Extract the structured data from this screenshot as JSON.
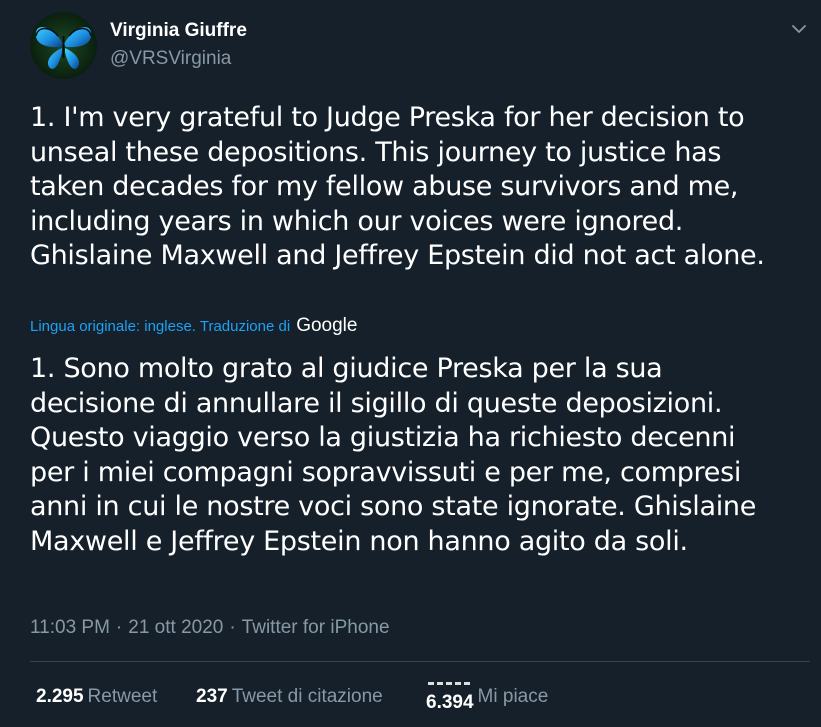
{
  "author": {
    "display_name": "Virginia Giuffre",
    "handle": "@VRSVirginia",
    "avatar_icon": "butterfly-avatar"
  },
  "menu": {
    "icon": "chevron-down-icon"
  },
  "tweet": {
    "text": "1. I'm very grateful to Judge Preska for her decision to\nunseal these depositions. This journey to justice has\ntaken decades for my fellow abuse survivors and me,\nincluding years in which our voices were ignored.\nGhislaine Maxwell and Jeffrey Epstein did not act alone.",
    "translation_note": "Lingua originale: inglese. Traduzione di",
    "translation_provider": "Google",
    "translated_text": "1. Sono molto grato al giudice Preska per la sua\ndecisione di annullare il sigillo di queste deposizioni.\nQuesto viaggio verso la giustizia ha richiesto decenni\nper i miei compagni sopravvissuti e per me, compresi\nanni in cui le nostre voci sono state ignorate. Ghislaine\nMaxwell e Jeffrey Epstein non hanno agito da soli.",
    "time": "11:03 PM",
    "separator": "·",
    "date": "21 ott 2020",
    "source": "Twitter for iPhone"
  },
  "stats": {
    "retweets_count": "2.295",
    "retweets_label": "Retweet",
    "quotes_count": "237",
    "quotes_label": "Tweet di citazione",
    "likes_count": "6.394",
    "likes_label": "Mi piace"
  },
  "colors": {
    "background": "#15202b",
    "text_primary": "#ffffff",
    "text_secondary": "#8899a6",
    "accent": "#1da1f2",
    "divider": "#38444d"
  }
}
